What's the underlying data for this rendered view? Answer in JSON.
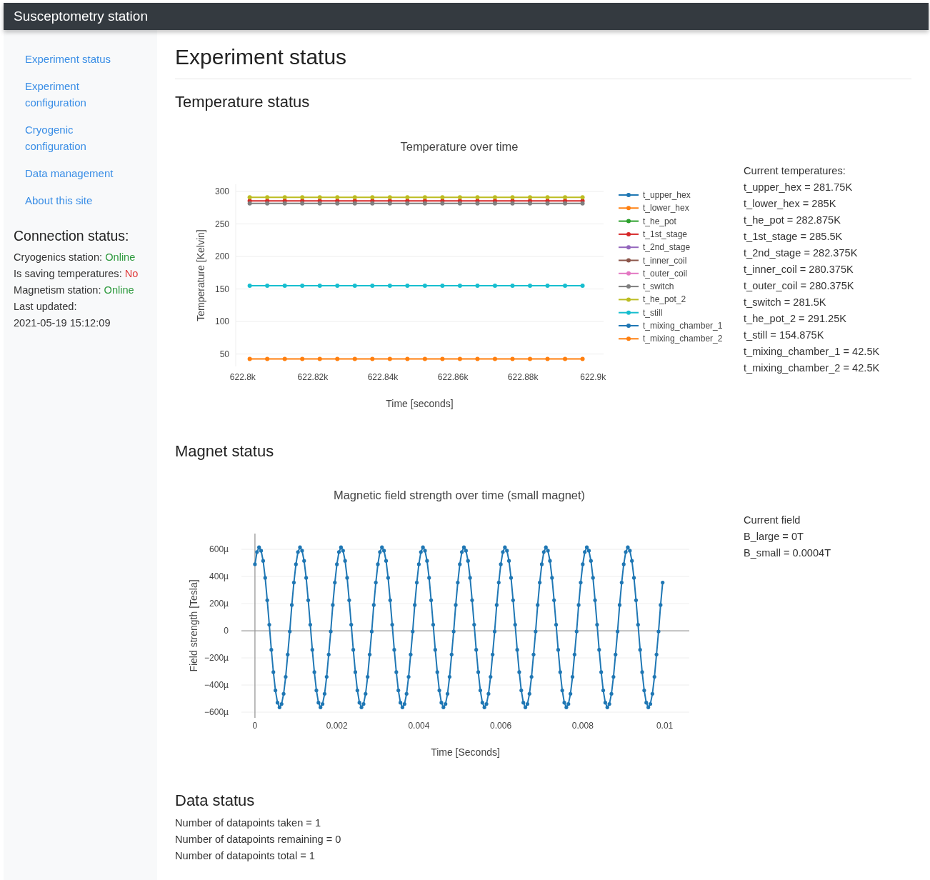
{
  "navbar": {
    "brand": "Susceptometry station"
  },
  "sidebar": {
    "links": [
      {
        "label": "Experiment status"
      },
      {
        "label": "Experiment configuration"
      },
      {
        "label": "Cryogenic configuration"
      },
      {
        "label": "Data management"
      },
      {
        "label": "About this site"
      }
    ],
    "connection_status": {
      "title": "Connection status:",
      "items": [
        {
          "label": "Cryogenics station:",
          "value": "Online",
          "ok": true
        },
        {
          "label": "Is saving temperatures:",
          "value": "No",
          "ok": false
        },
        {
          "label": "Magnetism station:",
          "value": "Online",
          "ok": true
        }
      ],
      "last_updated": {
        "label": "Last updated:",
        "value": "2021-05-19 15:12:09"
      }
    }
  },
  "main": {
    "title": "Experiment status",
    "sections": [
      {
        "kind": "chart",
        "heading": "Temperature status",
        "chart_data": {
          "type": "line",
          "title": "Temperature over time",
          "xlabel": "Time [seconds]",
          "ylabel": "Temperature [Kelvin]",
          "grid": true,
          "legend": "right",
          "xlim": [
            622798,
            622903
          ],
          "ylim": [
            31,
            311
          ],
          "x": [
            622802,
            622807,
            622812,
            622817,
            622822,
            622827,
            622832,
            622837,
            622842,
            622847,
            622852,
            622857,
            622862,
            622867,
            622872,
            622877,
            622882,
            622887,
            622892,
            622897
          ],
          "xticks": [
            {
              "value": 622800,
              "label": "622.8k"
            },
            {
              "value": 622820,
              "label": "622.82k"
            },
            {
              "value": 622840,
              "label": "622.84k"
            },
            {
              "value": 622860,
              "label": "622.86k"
            },
            {
              "value": 622880,
              "label": "622.88k"
            },
            {
              "value": 622900,
              "label": "622.9k"
            }
          ],
          "yticks": [
            50,
            100,
            150,
            200,
            250,
            300
          ],
          "series": [
            {
              "name": "t_upper_hex",
              "color": "#1f77b4",
              "marker": true,
              "values": [
                null,
                null,
                null,
                null,
                null,
                null,
                null,
                null,
                null,
                null,
                null,
                null,
                null,
                null,
                null,
                null,
                null,
                null,
                null,
                null
              ]
            },
            {
              "name": "t_lower_hex",
              "color": "#ff7f0e",
              "marker": true,
              "values": [
                null,
                null,
                null,
                null,
                null,
                null,
                null,
                null,
                null,
                null,
                null,
                null,
                null,
                null,
                null,
                null,
                null,
                null,
                null,
                null
              ]
            },
            {
              "name": "t_he_pot",
              "color": "#2ca02c",
              "marker": true,
              "values": [
                null,
                null,
                null,
                null,
                null,
                null,
                null,
                null,
                null,
                null,
                null,
                null,
                null,
                null,
                null,
                null,
                null,
                null,
                null,
                null
              ]
            },
            {
              "name": "t_1st_stage",
              "color": "#d62728",
              "marker": true,
              "values": [
                285.5,
                285.5,
                285.5,
                285.5,
                285.5,
                285.5,
                285.5,
                285.5,
                285.5,
                285.5,
                285.5,
                285.5,
                285.5,
                285.5,
                285.5,
                285.5,
                285.5,
                285.5,
                285.5,
                285.5
              ]
            },
            {
              "name": "t_2nd_stage",
              "color": "#9467bd",
              "marker": true,
              "values": [
                null,
                null,
                null,
                null,
                null,
                null,
                null,
                null,
                null,
                null,
                null,
                null,
                null,
                null,
                null,
                null,
                null,
                null,
                null,
                null
              ]
            },
            {
              "name": "t_inner_coil",
              "color": "#8c564b",
              "marker": true,
              "values": [
                null,
                null,
                null,
                null,
                null,
                null,
                null,
                null,
                null,
                null,
                null,
                null,
                null,
                null,
                null,
                null,
                null,
                null,
                null,
                null
              ]
            },
            {
              "name": "t_outer_coil",
              "color": "#e377c2",
              "marker": true,
              "values": [
                null,
                null,
                null,
                null,
                null,
                null,
                null,
                null,
                null,
                null,
                null,
                null,
                null,
                null,
                null,
                null,
                null,
                null,
                null,
                null
              ]
            },
            {
              "name": "t_switch",
              "color": "#7f7f7f",
              "marker": true,
              "values": [
                281.5,
                281.5,
                281.5,
                281.5,
                281.5,
                281.5,
                281.5,
                281.5,
                281.5,
                281.5,
                281.5,
                281.5,
                281.5,
                281.5,
                281.5,
                281.5,
                281.5,
                281.5,
                281.5,
                281.5
              ]
            },
            {
              "name": "t_he_pot_2",
              "color": "#bcbd22",
              "marker": true,
              "values": [
                291,
                291,
                291,
                291,
                291,
                291,
                291,
                291,
                291,
                291,
                291,
                291,
                291,
                291,
                291,
                291,
                291,
                291,
                291,
                291
              ]
            },
            {
              "name": "t_still",
              "color": "#17becf",
              "marker": true,
              "values": [
                155,
                155,
                155,
                155,
                155,
                155,
                155,
                155,
                155,
                155,
                155,
                155,
                155,
                155,
                155,
                155,
                155,
                155,
                155,
                155
              ]
            },
            {
              "name": "t_mixing_chamber_1",
              "color": "#1f77b4",
              "marker": true,
              "values": [
                null,
                null,
                null,
                null,
                null,
                null,
                null,
                null,
                null,
                null,
                null,
                null,
                null,
                null,
                null,
                null,
                null,
                null,
                null,
                null
              ]
            },
            {
              "name": "t_mixing_chamber_2",
              "color": "#ff7f0e",
              "marker": true,
              "values": [
                42.5,
                42.5,
                42.5,
                42.5,
                42.5,
                42.5,
                42.5,
                42.5,
                42.5,
                42.5,
                42.5,
                42.5,
                42.5,
                42.5,
                42.5,
                42.5,
                42.5,
                42.5,
                42.5,
                42.5
              ]
            }
          ]
        },
        "readings": {
          "title": "Current temperatures:",
          "lines": [
            "t_upper_hex = 281.75K",
            "t_lower_hex = 285K",
            "t_he_pot = 282.875K",
            "t_1st_stage = 285.5K",
            "t_2nd_stage = 282.375K",
            "t_inner_coil = 280.375K",
            "t_outer_coil = 280.375K",
            "t_switch = 281.5K",
            "t_he_pot_2 = 291.25K",
            "t_still = 154.875K",
            "t_mixing_chamber_1 = 42.5K",
            "t_mixing_chamber_2 = 42.5K"
          ]
        }
      },
      {
        "kind": "chart",
        "heading": "Magnet status",
        "chart_data": {
          "type": "line",
          "title": "Magnetic field strength over time (small magnet)",
          "xlabel": "Time [Seconds]",
          "ylabel": "Field strength [Tesla]",
          "grid": true,
          "xlim": [
            -0.00033,
            0.0106
          ],
          "ylim": [
            -642,
            716
          ],
          "x": [
            0,
            5e-05,
            0.0001,
            0.00015,
            0.0002,
            0.00025,
            0.0003,
            0.00035,
            0.0004,
            0.00045,
            0.0005,
            0.00055,
            0.0006,
            0.00065,
            0.0007,
            0.00075,
            0.0008,
            0.00085,
            0.0009,
            0.00095,
            0.001,
            0.00105,
            0.0011,
            0.00115,
            0.0012,
            0.00125,
            0.0013,
            0.00135,
            0.0014,
            0.00145,
            0.0015,
            0.00155,
            0.0016,
            0.00165,
            0.0017,
            0.00175,
            0.0018,
            0.00185,
            0.0019,
            0.00195,
            0.002,
            0.00205,
            0.0021,
            0.00215,
            0.0022,
            0.00225,
            0.0023,
            0.00235,
            0.0024,
            0.00245,
            0.0025,
            0.00255,
            0.0026,
            0.00265,
            0.0027,
            0.00275,
            0.0028,
            0.00285,
            0.0029,
            0.00295,
            0.003,
            0.00305,
            0.0031,
            0.00315,
            0.0032,
            0.00325,
            0.0033,
            0.00335,
            0.0034,
            0.00345,
            0.0035,
            0.00355,
            0.0036,
            0.00365,
            0.0037,
            0.00375,
            0.0038,
            0.00385,
            0.0039,
            0.00395,
            0.004,
            0.00405,
            0.0041,
            0.00415,
            0.0042,
            0.00425,
            0.0043,
            0.00435,
            0.0044,
            0.00445,
            0.0045,
            0.00455,
            0.0046,
            0.00465,
            0.0047,
            0.00475,
            0.0048,
            0.00485,
            0.0049,
            0.00495,
            0.005,
            0.00505,
            0.0051,
            0.00515,
            0.0052,
            0.00525,
            0.0053,
            0.00535,
            0.0054,
            0.00545,
            0.0055,
            0.00555,
            0.0056,
            0.00565,
            0.0057,
            0.00575,
            0.0058,
            0.00585,
            0.0059,
            0.00595,
            0.006,
            0.00605,
            0.0061,
            0.00615,
            0.0062,
            0.00625,
            0.0063,
            0.00635,
            0.0064,
            0.00645,
            0.0065,
            0.00655,
            0.0066,
            0.00665,
            0.0067,
            0.00675,
            0.0068,
            0.00685,
            0.0069,
            0.00695,
            0.007,
            0.00705,
            0.0071,
            0.00715,
            0.0072,
            0.00725,
            0.0073,
            0.00735,
            0.0074,
            0.00745,
            0.0075,
            0.00755,
            0.0076,
            0.00765,
            0.0077,
            0.00775,
            0.0078,
            0.00785,
            0.0079,
            0.00795,
            0.008,
            0.00805,
            0.0081,
            0.00815,
            0.0082,
            0.00825,
            0.0083,
            0.00835,
            0.0084,
            0.00845,
            0.0085,
            0.00855,
            0.0086,
            0.00865,
            0.0087,
            0.00875,
            0.0088,
            0.00885,
            0.0089,
            0.00895,
            0.009,
            0.00905,
            0.0091,
            0.00915,
            0.0092,
            0.00925,
            0.0093,
            0.00935,
            0.0094,
            0.00945,
            0.0095,
            0.00955,
            0.0096,
            0.00965,
            0.0097,
            0.00975,
            0.0098,
            0.00985,
            0.0099,
            0.00995
          ],
          "xticks": [
            0,
            0.002,
            0.004,
            0.006,
            0.008,
            0.01
          ],
          "yticks": [
            {
              "value": -600,
              "label": "−600µ"
            },
            {
              "value": -400,
              "label": "−400µ"
            },
            {
              "value": -200,
              "label": "−200µ"
            },
            {
              "value": 0,
              "label": "0"
            },
            {
              "value": 200,
              "label": "200µ"
            },
            {
              "value": 400,
              "label": "400µ"
            },
            {
              "value": 600,
              "label": "600µ"
            }
          ],
          "series": [
            {
              "color": "#1f77b4",
              "marker": true,
              "values": [
                490,
                580,
                615,
                590,
                515,
                390,
                225,
                45,
                -140,
                -305,
                -440,
                -530,
                -565,
                -540,
                -465,
                -340,
                -175,
                -5,
                190,
                355,
                490,
                580,
                615,
                590,
                515,
                390,
                225,
                45,
                -140,
                -305,
                -440,
                -530,
                -565,
                -540,
                -465,
                -340,
                -175,
                -5,
                190,
                355,
                490,
                580,
                615,
                590,
                515,
                390,
                225,
                45,
                -140,
                -305,
                -440,
                -530,
                -565,
                -540,
                -465,
                -340,
                -175,
                -5,
                190,
                355,
                490,
                580,
                615,
                590,
                515,
                390,
                225,
                45,
                -140,
                -305,
                -440,
                -530,
                -565,
                -540,
                -465,
                -340,
                -175,
                -5,
                190,
                355,
                490,
                580,
                615,
                590,
                515,
                390,
                225,
                45,
                -140,
                -305,
                -440,
                -530,
                -565,
                -540,
                -465,
                -340,
                -175,
                -5,
                190,
                355,
                490,
                580,
                615,
                590,
                515,
                390,
                225,
                45,
                -140,
                -305,
                -440,
                -530,
                -565,
                -540,
                -465,
                -340,
                -175,
                -5,
                190,
                355,
                490,
                580,
                615,
                590,
                515,
                390,
                225,
                45,
                -140,
                -305,
                -440,
                -530,
                -565,
                -540,
                -465,
                -340,
                -175,
                -5,
                190,
                355,
                490,
                580,
                615,
                590,
                515,
                390,
                225,
                45,
                -140,
                -305,
                -440,
                -530,
                -565,
                -540,
                -465,
                -340,
                -175,
                -5,
                190,
                355,
                490,
                580,
                615,
                590,
                515,
                390,
                225,
                45,
                -140,
                -305,
                -440,
                -530,
                -565,
                -540,
                -465,
                -340,
                -175,
                -5,
                190,
                355,
                490,
                580,
                615,
                590,
                515,
                390,
                225,
                45,
                -140,
                -305,
                -440,
                -530,
                -565,
                -540,
                -465,
                -340,
                -175,
                -5,
                190,
                355
              ]
            }
          ]
        },
        "readings": {
          "title": "Current field",
          "lines": [
            "B_large = 0T",
            "B_small = 0.0004T"
          ]
        }
      },
      {
        "kind": "text",
        "heading": "Data status",
        "lines": [
          "Number of datapoints taken = 1",
          "Number of datapoints remaining = 0",
          "Number of datapoints total = 1"
        ]
      }
    ]
  }
}
